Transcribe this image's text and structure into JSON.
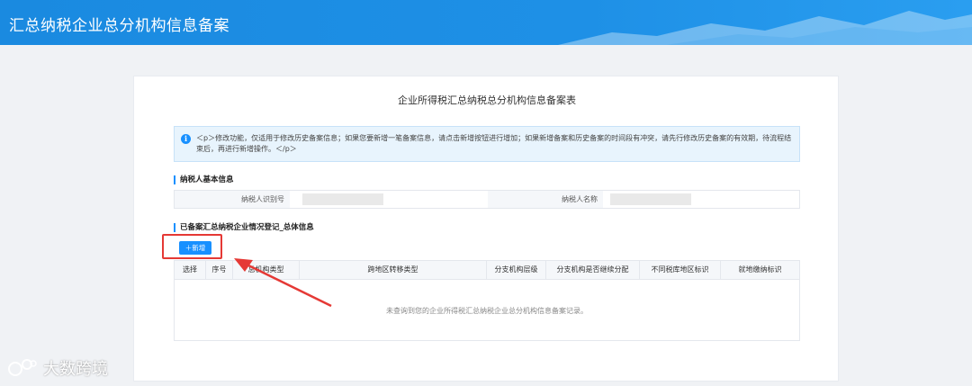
{
  "header": {
    "title": "汇总纳税企业总分机构信息备案"
  },
  "form": {
    "title": "企业所得税汇总纳税总分机构信息备案表",
    "notice": "＜p＞修改功能，仅适用于修改历史备案信息；如果您要新增一笔备案信息，请点击新增按钮进行增加；如果新增备案和历史备案的时间段有冲突，请先行修改历史备案的有效期，待流程结束后，再进行新增操作。＜/p＞"
  },
  "taxpayer": {
    "section_title": "纳税人基本信息",
    "id_label": "纳税人识别号",
    "name_label": "纳税人名称"
  },
  "record": {
    "section_title": "已备案汇总纳税企业情况登记_总体信息",
    "add_button": "＋新增",
    "columns": [
      "选择",
      "序号",
      "总机构类型",
      "跨地区转移类型",
      "分支机构层级",
      "分支机构是否继续分配",
      "不同税库地区标识",
      "就地缴纳标识"
    ],
    "empty_message": "未查询到您的企业所得税汇总纳税企业总分机构信息备案记录。"
  },
  "watermark": {
    "text": "大数跨境"
  },
  "colors": {
    "header": "#1e90e6",
    "accent": "#1890ff",
    "highlight": "#e53935"
  }
}
